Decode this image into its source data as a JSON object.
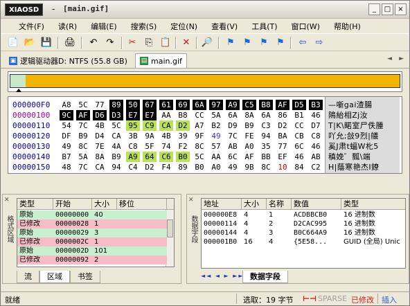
{
  "titlebar": {
    "logo": "XIAOSD",
    "dash": "-",
    "title": "[main.gif]",
    "buttons": [
      "_",
      "□",
      "×"
    ]
  },
  "menu": [
    "文件(F)",
    "读(R)",
    "编辑(E)",
    "搜索(S)",
    "定位(N)",
    "查看(V)",
    "工具(T)",
    "窗口(W)",
    "帮助(H)"
  ],
  "tabs": [
    {
      "label": "逻辑驱动器D: NTFS (55.8 GB)",
      "icon": "drive-icon"
    },
    {
      "label": "main.gif",
      "icon": "gif-file-icon"
    }
  ],
  "tab_nav": [
    "◄",
    "►"
  ],
  "filemap": {
    "orig_fraction": 0.04,
    "colors": {
      "modified": "#f2b400",
      "orig": "#c9e7c9"
    }
  },
  "hex": {
    "rows": [
      {
        "offset": "000000F0",
        "bytes": [
          "A8",
          "5C",
          "77",
          "89",
          "50",
          "67",
          "61",
          "69",
          "6A",
          "97",
          "A9",
          "C5",
          "B8",
          "AF",
          "D5",
          "B3"
        ],
        "text": "—噺gai渣腸"
      },
      {
        "offset": "00000100",
        "bytes": [
          "9C",
          "AF",
          "D6",
          "D3",
          "E7",
          "E7",
          "AA",
          "B8",
          "CC",
          "5A",
          "6A",
          "8A",
          "6A",
          "86",
          "B1",
          "46"
        ],
        "text": "隝紿相Zj汝"
      },
      {
        "offset": "00000110",
        "bytes": [
          "54",
          "7C",
          "4B",
          "5C",
          "95",
          "C9",
          "CA",
          "D2",
          "A7",
          "B2",
          "D9",
          "B9",
          "C3",
          "D2",
          "CC",
          "D7"
        ],
        "text": "T|K\\睰室尸佚腫"
      },
      {
        "offset": "00000120",
        "bytes": [
          "DF",
          "B9",
          "D4",
          "CA",
          "3B",
          "9A",
          "4B",
          "39",
          "9F",
          "49",
          "7C",
          "FE",
          "94",
          "BA",
          "CB",
          "C8"
        ],
        "text": "吖允;敆9烈|艤"
      },
      {
        "offset": "00000130",
        "bytes": [
          "49",
          "8C",
          "7E",
          "4A",
          "C8",
          "5F",
          "74",
          "F2",
          "8C",
          "57",
          "AB",
          "A0",
          "35",
          "77",
          "6C",
          "46"
        ],
        "text": "奚J肃t蝠W朼5"
      },
      {
        "offset": "00000140",
        "bytes": [
          "B7",
          "5A",
          "8A",
          "B9",
          "A9",
          "64",
          "C6",
          "B0",
          "5C",
          "AA",
          "6C",
          "AF",
          "BB",
          "EF",
          "46",
          "AB"
        ],
        "text": "稹娩゛瓢\\端"
      },
      {
        "offset": "00000150",
        "bytes": [
          "48",
          "7C",
          "CA",
          "94",
          "C4",
          "D2",
          "F4",
          "89",
          "B0",
          "A0",
          "49",
          "9B",
          "8C",
          "10",
          "84",
          "C2"
        ],
        "text": "H|蔭寒艳杰I鐐"
      }
    ]
  },
  "left_panel": {
    "label": "格式区域",
    "columns": [
      "类型",
      "开始",
      "大小",
      "移位"
    ],
    "rows": [
      {
        "type": "原始",
        "start": "00000000",
        "size": "40",
        "shift": "",
        "kind": "orig"
      },
      {
        "type": "已修改",
        "start": "00000028",
        "size": "1",
        "shift": "",
        "kind": "mod"
      },
      {
        "type": "原始",
        "start": "00000029",
        "size": "3",
        "shift": "",
        "kind": "orig"
      },
      {
        "type": "已修改",
        "start": "0000002C",
        "size": "1",
        "shift": "",
        "kind": "mod"
      },
      {
        "type": "原始",
        "start": "0000002D",
        "size": "101",
        "shift": "",
        "kind": "orig"
      },
      {
        "type": "已修改",
        "start": "00000092",
        "size": "2",
        "shift": "",
        "kind": "mod"
      }
    ],
    "tabs": [
      "流",
      "区域",
      "书签"
    ],
    "active_tab": 1
  },
  "right_panel": {
    "label": "数据字段",
    "columns": [
      "地址",
      "大小",
      "名称",
      "数值",
      "类型"
    ],
    "rows": [
      {
        "addr": "000000E8",
        "size": "4",
        "name": "1",
        "value": "ACDBBCB0",
        "type": "16 进制数"
      },
      {
        "addr": "00000114",
        "size": "4",
        "name": "2",
        "value": "D2CAC995",
        "type": "16 进制数"
      },
      {
        "addr": "00000144",
        "size": "4",
        "name": "3",
        "value": "B0C664A9",
        "type": "16 进制数"
      },
      {
        "addr": "000001B0",
        "size": "16",
        "name": "4",
        "value": "{5E58...",
        "type": "GUID (全局) Unic"
      }
    ],
    "tab": "数据字段",
    "nav": "◄◄ ◄ ► ►►"
  },
  "status": {
    "ready": "就绪",
    "selection": "选取：19 字节",
    "sparse": "SPARSE",
    "modified": "已修改",
    "insert": "插入"
  }
}
